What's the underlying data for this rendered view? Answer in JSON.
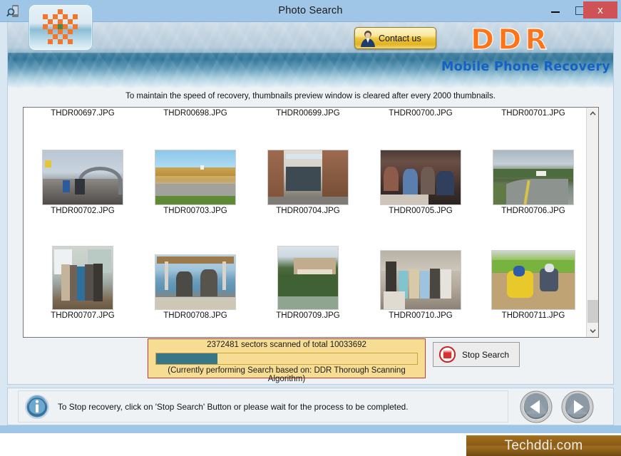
{
  "window": {
    "title": "Photo Search",
    "app_icon": "mobile-phone-search-icon",
    "minimize_label": "Minimize",
    "maximize_label": "Maximize",
    "close_label": "x"
  },
  "header": {
    "logo_icon": "checkerboard-logo-icon",
    "contact_button": "Contact us",
    "contact_icon": "person-icon",
    "brand": "DDR",
    "tagline": "Mobile Phone Recovery"
  },
  "notice": {
    "text": "To maintain the speed of recovery, thumbnails preview window is cleared after every 2000 thumbnails."
  },
  "thumbnails": {
    "rows": [
      {
        "labels_above": [
          "THDR00697.JPG",
          "THDR00698.JPG",
          "THDR00699.JPG",
          "THDR00700.JPG",
          "THDR00701.JPG"
        ],
        "items": [
          {
            "label": "THDR00702.JPG",
            "photo": "boardwalk-cyclists-photo",
            "shape": "wide",
            "style": "p1"
          },
          {
            "label": "THDR00703.JPG",
            "photo": "autumn-trees-parking-lot-photo",
            "shape": "wide",
            "style": "p2"
          },
          {
            "label": "THDR00704.JPG",
            "photo": "storefront-building-photo",
            "shape": "wide",
            "style": "p3"
          },
          {
            "label": "THDR00705.JPG",
            "photo": "banquet-crowd-photo",
            "shape": "wide",
            "style": "p4"
          },
          {
            "label": "THDR00706.JPG",
            "photo": "country-road-photo",
            "shape": "wide",
            "style": "p5"
          }
        ]
      },
      {
        "items": [
          {
            "label": "THDR00707.JPG",
            "photo": "conference-poster-group-photo",
            "shape": "portrait",
            "style": "p6"
          },
          {
            "label": "THDR00708.JPG",
            "photo": "men-on-boat-photo",
            "shape": "wide",
            "style": "p7"
          },
          {
            "label": "THDR00709.JPG",
            "photo": "hillside-resort-photo",
            "shape": "portrait",
            "style": "p8"
          },
          {
            "label": "THDR00710.JPG",
            "photo": "group-by-stone-wall-photo",
            "shape": "wide",
            "style": "p9"
          },
          {
            "label": "THDR00711.JPG",
            "photo": "motocross-riders-photo",
            "shape": "wide",
            "style": "p10"
          }
        ]
      }
    ]
  },
  "scrollbar": {
    "up_arrow": "chevron-up-icon",
    "down_arrow": "chevron-down-icon",
    "thumb_position_percent": 82,
    "thumb_size_percent": 10
  },
  "progress": {
    "status_text": "2372481 sectors scanned of total 10033692",
    "sectors_scanned": 2372481,
    "sectors_total": 10033692,
    "percent": 23.6,
    "algorithm_text": "(Currently performing Search based on:  DDR Thorough Scanning Algorithm)",
    "fill_color": "#377589",
    "panel_bg": "#f6dd93",
    "panel_border": "#c23b2e"
  },
  "stop_button": {
    "label": "Stop Search",
    "icon": "stop-circle-icon",
    "icon_color": "#cc2222"
  },
  "footer": {
    "info_icon": "info-icon",
    "info_text": "To Stop recovery, click on 'Stop Search' Button or please wait for the process to be completed.",
    "prev_button": "previous-step-button",
    "next_button": "next-step-button"
  },
  "badge": {
    "text": "Techddi.com"
  }
}
